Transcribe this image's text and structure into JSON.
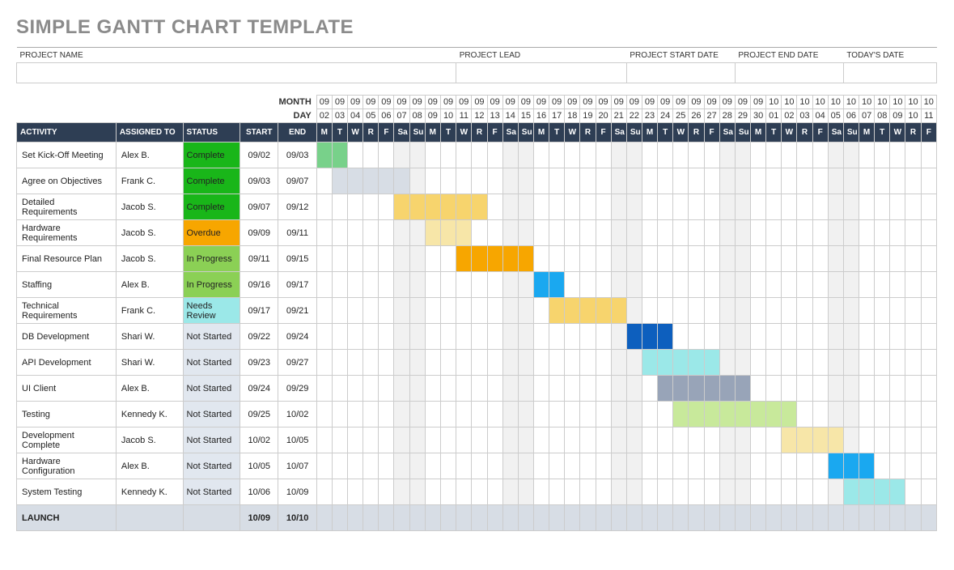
{
  "title": "SIMPLE GANTT CHART TEMPLATE",
  "meta_labels": {
    "project_name": "PROJECT NAME",
    "project_lead": "PROJECT LEAD",
    "start_date": "PROJECT START DATE",
    "end_date": "PROJECT END DATE",
    "todays_date": "TODAY'S DATE"
  },
  "row_labels": {
    "month": "MONTH",
    "day": "DAY"
  },
  "headers": {
    "activity": "ACTIVITY",
    "assigned_to": "ASSIGNED TO",
    "status": "STATUS",
    "start": "START",
    "end": "END"
  },
  "dow": [
    "M",
    "T",
    "W",
    "R",
    "F",
    "Sa",
    "Su"
  ],
  "days": [
    {
      "m": "09",
      "d": "02",
      "w": 0
    },
    {
      "m": "09",
      "d": "03",
      "w": 1
    },
    {
      "m": "09",
      "d": "04",
      "w": 2
    },
    {
      "m": "09",
      "d": "05",
      "w": 3
    },
    {
      "m": "09",
      "d": "06",
      "w": 4
    },
    {
      "m": "09",
      "d": "07",
      "w": 5
    },
    {
      "m": "09",
      "d": "08",
      "w": 6
    },
    {
      "m": "09",
      "d": "09",
      "w": 0
    },
    {
      "m": "09",
      "d": "10",
      "w": 1
    },
    {
      "m": "09",
      "d": "11",
      "w": 2
    },
    {
      "m": "09",
      "d": "12",
      "w": 3
    },
    {
      "m": "09",
      "d": "13",
      "w": 4
    },
    {
      "m": "09",
      "d": "14",
      "w": 5
    },
    {
      "m": "09",
      "d": "15",
      "w": 6
    },
    {
      "m": "09",
      "d": "16",
      "w": 0
    },
    {
      "m": "09",
      "d": "17",
      "w": 1
    },
    {
      "m": "09",
      "d": "18",
      "w": 2
    },
    {
      "m": "09",
      "d": "19",
      "w": 3
    },
    {
      "m": "09",
      "d": "20",
      "w": 4
    },
    {
      "m": "09",
      "d": "21",
      "w": 5
    },
    {
      "m": "09",
      "d": "22",
      "w": 6
    },
    {
      "m": "09",
      "d": "23",
      "w": 0
    },
    {
      "m": "09",
      "d": "24",
      "w": 1
    },
    {
      "m": "09",
      "d": "25",
      "w": 2
    },
    {
      "m": "09",
      "d": "26",
      "w": 3
    },
    {
      "m": "09",
      "d": "27",
      "w": 4
    },
    {
      "m": "09",
      "d": "28",
      "w": 5
    },
    {
      "m": "09",
      "d": "29",
      "w": 6
    },
    {
      "m": "09",
      "d": "30",
      "w": 0
    },
    {
      "m": "10",
      "d": "01",
      "w": 1
    },
    {
      "m": "10",
      "d": "02",
      "w": 2
    },
    {
      "m": "10",
      "d": "03",
      "w": 3
    },
    {
      "m": "10",
      "d": "04",
      "w": 4
    },
    {
      "m": "10",
      "d": "05",
      "w": 5
    },
    {
      "m": "10",
      "d": "06",
      "w": 6
    },
    {
      "m": "10",
      "d": "07",
      "w": 0
    },
    {
      "m": "10",
      "d": "08",
      "w": 1
    },
    {
      "m": "10",
      "d": "09",
      "w": 2
    },
    {
      "m": "10",
      "d": "10",
      "w": 3
    },
    {
      "m": "10",
      "d": "11",
      "w": 4
    }
  ],
  "tasks": [
    {
      "name": "Set Kick-Off Meeting",
      "assigned": "Alex B.",
      "status": "Complete",
      "start": "09/02",
      "end": "09/03",
      "bar": {
        "from": 0,
        "to": 1,
        "cls": "b1"
      }
    },
    {
      "name": "Agree on Objectives",
      "assigned": "Frank C.",
      "status": "Complete",
      "start": "09/03",
      "end": "09/07",
      "bar": {
        "from": 1,
        "to": 5,
        "cls": "b2"
      }
    },
    {
      "name": "Detailed Requirements",
      "assigned": "Jacob S.",
      "status": "Complete",
      "start": "09/07",
      "end": "09/12",
      "bar": {
        "from": 5,
        "to": 10,
        "cls": "b3"
      }
    },
    {
      "name": "Hardware Requirements",
      "assigned": "Jacob S.",
      "status": "Overdue",
      "start": "09/09",
      "end": "09/11",
      "bar": {
        "from": 7,
        "to": 9,
        "cls": "b4"
      }
    },
    {
      "name": "Final Resource Plan",
      "assigned": "Jacob S.",
      "status": "In Progress",
      "start": "09/11",
      "end": "09/15",
      "bar": {
        "from": 9,
        "to": 13,
        "cls": "b5"
      }
    },
    {
      "name": "Staffing",
      "assigned": "Alex B.",
      "status": "In Progress",
      "start": "09/16",
      "end": "09/17",
      "bar": {
        "from": 14,
        "to": 15,
        "cls": "b6"
      }
    },
    {
      "name": "Technical Requirements",
      "assigned": "Frank C.",
      "status": "Needs Review",
      "start": "09/17",
      "end": "09/21",
      "bar": {
        "from": 15,
        "to": 19,
        "cls": "b7"
      }
    },
    {
      "name": "DB Development",
      "assigned": "Shari W.",
      "status": "Not Started",
      "start": "09/22",
      "end": "09/24",
      "bar": {
        "from": 20,
        "to": 22,
        "cls": "b8"
      }
    },
    {
      "name": "API Development",
      "assigned": "Shari W.",
      "status": "Not Started",
      "start": "09/23",
      "end": "09/27",
      "bar": {
        "from": 21,
        "to": 25,
        "cls": "b9"
      }
    },
    {
      "name": "UI Client",
      "assigned": "Alex B.",
      "status": "Not Started",
      "start": "09/24",
      "end": "09/29",
      "bar": {
        "from": 22,
        "to": 27,
        "cls": "b10"
      }
    },
    {
      "name": "Testing",
      "assigned": "Kennedy K.",
      "status": "Not Started",
      "start": "09/25",
      "end": "10/02",
      "bar": {
        "from": 23,
        "to": 30,
        "cls": "b11"
      }
    },
    {
      "name": "Development Complete",
      "assigned": "Jacob S.",
      "status": "Not Started",
      "start": "10/02",
      "end": "10/05",
      "bar": {
        "from": 30,
        "to": 33,
        "cls": "b13"
      }
    },
    {
      "name": "Hardware Configuration",
      "assigned": "Alex B.",
      "status": "Not Started",
      "start": "10/05",
      "end": "10/07",
      "bar": {
        "from": 33,
        "to": 35,
        "cls": "b6"
      }
    },
    {
      "name": "System Testing",
      "assigned": "Kennedy K.",
      "status": "Not Started",
      "start": "10/06",
      "end": "10/09",
      "bar": {
        "from": 34,
        "to": 37,
        "cls": "b9"
      }
    },
    {
      "name": "LAUNCH",
      "assigned": "",
      "status": "",
      "start": "10/09",
      "end": "10/10",
      "bar": {
        "from": 37,
        "to": 38,
        "cls": "b12"
      },
      "launch": true
    }
  ],
  "chart_data": {
    "type": "gantt",
    "title": "Simple Gantt Chart Template",
    "date_range": {
      "start": "09/02",
      "end": "10/11"
    },
    "columns": [
      "ACTIVITY",
      "ASSIGNED TO",
      "STATUS",
      "START",
      "END"
    ],
    "status_values": [
      "Complete",
      "Overdue",
      "In Progress",
      "Needs Review",
      "Not Started"
    ],
    "series": [
      {
        "activity": "Set Kick-Off Meeting",
        "assigned_to": "Alex B.",
        "status": "Complete",
        "start": "09/02",
        "end": "09/03"
      },
      {
        "activity": "Agree on Objectives",
        "assigned_to": "Frank C.",
        "status": "Complete",
        "start": "09/03",
        "end": "09/07"
      },
      {
        "activity": "Detailed Requirements",
        "assigned_to": "Jacob S.",
        "status": "Complete",
        "start": "09/07",
        "end": "09/12"
      },
      {
        "activity": "Hardware Requirements",
        "assigned_to": "Jacob S.",
        "status": "Overdue",
        "start": "09/09",
        "end": "09/11"
      },
      {
        "activity": "Final Resource Plan",
        "assigned_to": "Jacob S.",
        "status": "In Progress",
        "start": "09/11",
        "end": "09/15"
      },
      {
        "activity": "Staffing",
        "assigned_to": "Alex B.",
        "status": "In Progress",
        "start": "09/16",
        "end": "09/17"
      },
      {
        "activity": "Technical Requirements",
        "assigned_to": "Frank C.",
        "status": "Needs Review",
        "start": "09/17",
        "end": "09/21"
      },
      {
        "activity": "DB Development",
        "assigned_to": "Shari W.",
        "status": "Not Started",
        "start": "09/22",
        "end": "09/24"
      },
      {
        "activity": "API Development",
        "assigned_to": "Shari W.",
        "status": "Not Started",
        "start": "09/23",
        "end": "09/27"
      },
      {
        "activity": "UI Client",
        "assigned_to": "Alex B.",
        "status": "Not Started",
        "start": "09/24",
        "end": "09/29"
      },
      {
        "activity": "Testing",
        "assigned_to": "Kennedy K.",
        "status": "Not Started",
        "start": "09/25",
        "end": "10/02"
      },
      {
        "activity": "Development Complete",
        "assigned_to": "Jacob S.",
        "status": "Not Started",
        "start": "10/02",
        "end": "10/05"
      },
      {
        "activity": "Hardware Configuration",
        "assigned_to": "Alex B.",
        "status": "Not Started",
        "start": "10/05",
        "end": "10/07"
      },
      {
        "activity": "System Testing",
        "assigned_to": "Kennedy K.",
        "status": "Not Started",
        "start": "10/06",
        "end": "10/09"
      },
      {
        "activity": "LAUNCH",
        "assigned_to": "",
        "status": "",
        "start": "10/09",
        "end": "10/10"
      }
    ]
  }
}
